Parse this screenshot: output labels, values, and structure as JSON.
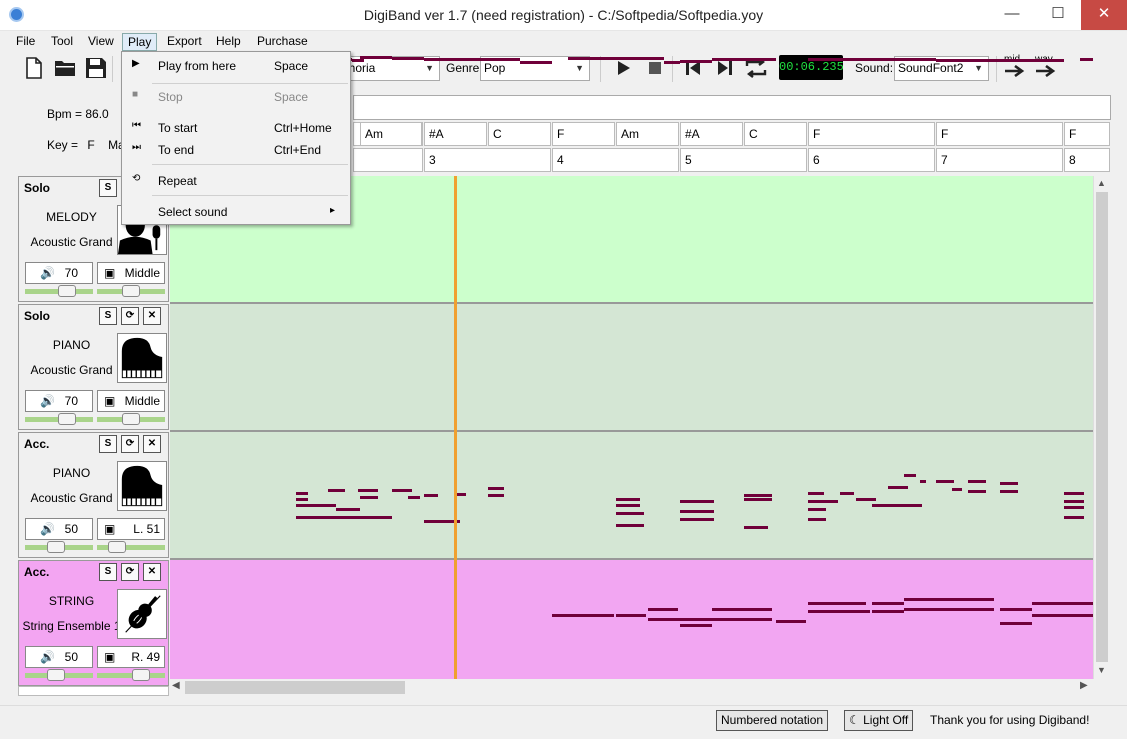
{
  "window": {
    "title": "DigiBand ver 1.7  (need registration)  -  C:/Softpedia/Softpedia.yoy",
    "minimize": "—",
    "maximize": "☐",
    "close": "✕"
  },
  "menubar": [
    "File",
    "Tool",
    "View",
    "Play",
    "Export",
    "Help",
    "Purchase"
  ],
  "toolbar": {
    "style_partial": "phoria",
    "genre_label": "Genre",
    "genre_value": "Pop",
    "time": "00:06.235",
    "sound_label": "Sound:",
    "sound_value": "SoundFont2",
    "mid_label": "mid",
    "wav_label": "wav"
  },
  "play_menu": {
    "items": [
      {
        "label": "Play from here",
        "shortcut": "Space",
        "icon": "play-icon"
      },
      {
        "label": "Stop",
        "shortcut": "Space",
        "icon": "stop-icon",
        "disabled": true
      },
      {
        "label": "To start",
        "shortcut": "Ctrl+Home",
        "icon": "to-start-icon"
      },
      {
        "label": "To end",
        "shortcut": "Ctrl+End",
        "icon": "to-end-icon"
      },
      {
        "label": "Repeat",
        "shortcut": "",
        "icon": "repeat-icon"
      },
      {
        "label": "Select sound",
        "shortcut": "▸",
        "icon": ""
      }
    ]
  },
  "info": {
    "bpm": "Bpm = 86.0",
    "key_label": "Key =",
    "key_value": "F",
    "mode_partial": "Ma"
  },
  "chords": [
    "Am",
    "#A",
    "C",
    "F",
    "Am",
    "#A",
    "C",
    "F",
    "F",
    "F"
  ],
  "bars": [
    "3",
    "4",
    "5",
    "6",
    "7",
    "8"
  ],
  "tracks": [
    {
      "title": "Solo",
      "name": "MELODY",
      "instrument": "Acoustic Grand",
      "volume": "70",
      "pan": "Middle",
      "icon": "singer-icon",
      "vol_level": 0.62,
      "pan_level": 0.5
    },
    {
      "title": "Solo",
      "name": "PIANO",
      "instrument": "Acoustic Grand",
      "volume": "70",
      "pan": "Middle",
      "icon": "piano-icon",
      "vol_level": 0.62,
      "pan_level": 0.5
    },
    {
      "title": "Acc.",
      "name": "PIANO",
      "instrument": "Acoustic Grand",
      "volume": "50",
      "pan": "L. 51",
      "icon": "piano-icon",
      "vol_level": 0.45,
      "pan_level": 0.3
    },
    {
      "title": "Acc.",
      "name": "STRING",
      "instrument": "String Ensemble 1",
      "volume": "50",
      "pan": "R. 49",
      "icon": "violin-icon",
      "vol_level": 0.45,
      "pan_level": 0.65
    }
  ],
  "track_buttons": {
    "solo": "S",
    "loop": "⟳",
    "delete": "✕"
  },
  "status": {
    "notation": "Numbered notation",
    "light": "Light Off",
    "message": "Thank you for using Digiband!"
  },
  "colors": {
    "lane_melody": "#ccffcc",
    "lane_piano": "#d4e6d4",
    "lane_string": "#f2a6f2",
    "note": "#70003a",
    "playhead": "#f0a030",
    "time_text": "#20e040"
  }
}
